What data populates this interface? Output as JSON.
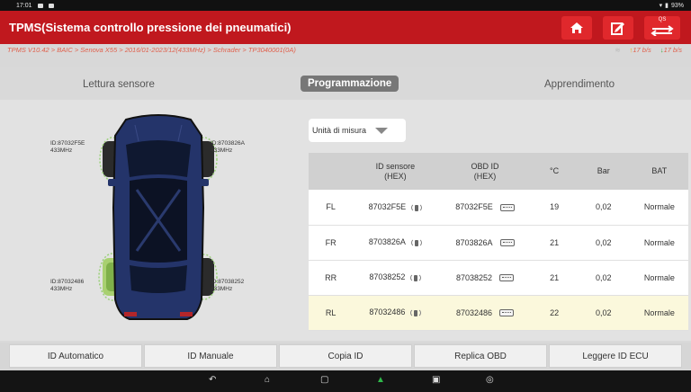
{
  "statusbar": {
    "time": "17:01",
    "battery": "93%"
  },
  "header": {
    "title": "TPMS(Sistema controllo pressione dei pneumatici)",
    "buttons": [
      "home-icon",
      "report-icon",
      "data-transfer-icon"
    ],
    "transfer_label": "QS"
  },
  "breadcrumb": "TPMS V10.42 > BAIC > Senova X55 > 2016/01-2023/12(433MHz) > Schrader > TP3040001(0A)",
  "speeds": {
    "up": "17 b/s",
    "down": "17 b/s"
  },
  "tabs": [
    "Lettura sensore",
    "Programmazione",
    "Apprendimento"
  ],
  "active_tab": "Programmazione",
  "sensors": {
    "fl": {
      "id": "ID:87032F5E",
      "freq": "433MHz"
    },
    "fr": {
      "id": "ID:8703826A",
      "freq": "433MHz"
    },
    "rl": {
      "id": "ID:87032486",
      "freq": "433MHz"
    },
    "rr": {
      "id": "ID:87038252",
      "freq": "433MHz"
    }
  },
  "unit_dropdown": {
    "label": "Unità di misura"
  },
  "table": {
    "headers": {
      "wheel": "",
      "sensor_id": "ID sensore",
      "sensor_id_sub": "(HEX)",
      "obd_id": "OBD ID",
      "obd_id_sub": "(HEX)",
      "temp": "°C",
      "bar": "Bar",
      "bat": "BAT"
    },
    "rows": [
      {
        "wheel": "FL",
        "sensor_id": "87032F5E",
        "obd_id": "87032F5E",
        "temp": "19",
        "bar": "0,02",
        "bat": "Normale"
      },
      {
        "wheel": "FR",
        "sensor_id": "8703826A",
        "obd_id": "8703826A",
        "temp": "21",
        "bar": "0,02",
        "bat": "Normale"
      },
      {
        "wheel": "RR",
        "sensor_id": "87038252",
        "obd_id": "87038252",
        "temp": "21",
        "bar": "0,02",
        "bat": "Normale"
      },
      {
        "wheel": "RL",
        "sensor_id": "87032486",
        "obd_id": "87032486",
        "temp": "22",
        "bar": "0,02",
        "bat": "Normale"
      }
    ]
  },
  "bottom_buttons": [
    "ID Automatico",
    "ID Manuale",
    "Copia ID",
    "Replica OBD",
    "Leggere ID ECU"
  ],
  "colors": {
    "header": "#c0181e",
    "highlight_row": "#fbf8dc",
    "selected_wheel": "#a8d070"
  }
}
